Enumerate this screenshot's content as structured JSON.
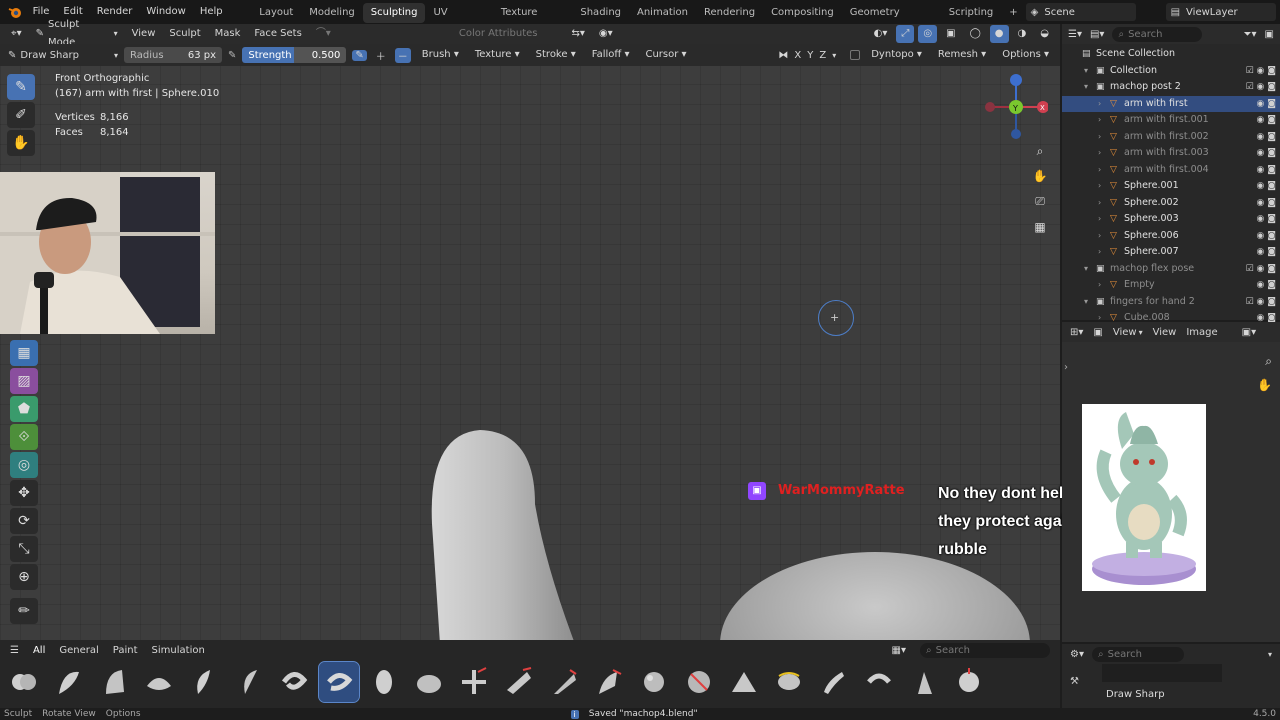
{
  "menubar": {
    "items": [
      "File",
      "Edit",
      "Render",
      "Window",
      "Help"
    ],
    "workspaces": [
      "Layout",
      "Modeling",
      "Sculpting",
      "UV Editing",
      "Texture Paint",
      "Shading",
      "Animation",
      "Rendering",
      "Compositing",
      "Geometry Nodes",
      "Scripting"
    ],
    "active_workspace": "Sculpting",
    "scene": "Scene",
    "view_layer": "ViewLayer"
  },
  "viewport_header": {
    "mode": "Sculpt Mode",
    "menus": [
      "View",
      "Sculpt",
      "Mask",
      "Face Sets"
    ],
    "color_attributes": "Color Attributes"
  },
  "tool_settings": {
    "brush_name": "Draw Sharp",
    "radius_label": "Radius",
    "radius_value": "63 px",
    "strength_label": "Strength",
    "strength_value": "0.500",
    "menus": [
      "Brush",
      "Texture",
      "Stroke",
      "Falloff",
      "Cursor"
    ],
    "axes": [
      "X",
      "Y",
      "Z"
    ],
    "dyntopo": "Dyntopo",
    "remesh": "Remesh",
    "options": "Options"
  },
  "viewport_info": {
    "view": "Front Orthographic",
    "object": "(167) arm with first | Sphere.010",
    "vertices_label": "Vertices",
    "vertices_value": "8,166",
    "faces_label": "Faces",
    "faces_value": "8,164"
  },
  "chat": {
    "username": "WarMommyRatte",
    "message": "No they dont help against rifle fire they protect against shrapnel and rubble",
    "line1": "No they dont help against rifle fire",
    "line2": "they protect against shrapnel and",
    "line3": "rubble"
  },
  "outliner": {
    "search_placeholder": "Search",
    "rows": [
      {
        "name": "Scene Collection",
        "indent": 0
      },
      {
        "name": "Collection",
        "indent": 1
      },
      {
        "name": "machop post 2",
        "indent": 1
      },
      {
        "name": "arm with first",
        "indent": 2,
        "selected": true
      },
      {
        "name": "arm with first.001",
        "indent": 2,
        "dim": true
      },
      {
        "name": "arm with first.002",
        "indent": 2,
        "dim": true
      },
      {
        "name": "arm with first.003",
        "indent": 2,
        "dim": true
      },
      {
        "name": "arm with first.004",
        "indent": 2,
        "dim": true
      },
      {
        "name": "Sphere.001",
        "indent": 2
      },
      {
        "name": "Sphere.002",
        "indent": 2
      },
      {
        "name": "Sphere.003",
        "indent": 2
      },
      {
        "name": "Sphere.006",
        "indent": 2
      },
      {
        "name": "Sphere.007",
        "indent": 2
      },
      {
        "name": "machop flex pose",
        "indent": 1,
        "dim": true
      },
      {
        "name": "Empty",
        "indent": 2,
        "dim": true
      },
      {
        "name": "fingers for hand 2",
        "indent": 1,
        "dim": true
      },
      {
        "name": "Cube.008",
        "indent": 2,
        "dim": true
      }
    ]
  },
  "image_editor": {
    "menus": [
      "View",
      "View",
      "Image"
    ]
  },
  "properties": {
    "search_placeholder": "Search",
    "brush_name": "Draw Sharp"
  },
  "brush_bar": {
    "tabs": [
      "All",
      "General",
      "Paint",
      "Simulation"
    ],
    "search_placeholder": "Search"
  },
  "statusbar": {
    "left_items": [
      "Sculpt",
      "Rotate View",
      "Options"
    ],
    "message": "Saved \"machop4.blend\"",
    "version": "4.5.0"
  },
  "colors": {
    "accent": "#4772b3",
    "chat_username": "#e02020"
  }
}
